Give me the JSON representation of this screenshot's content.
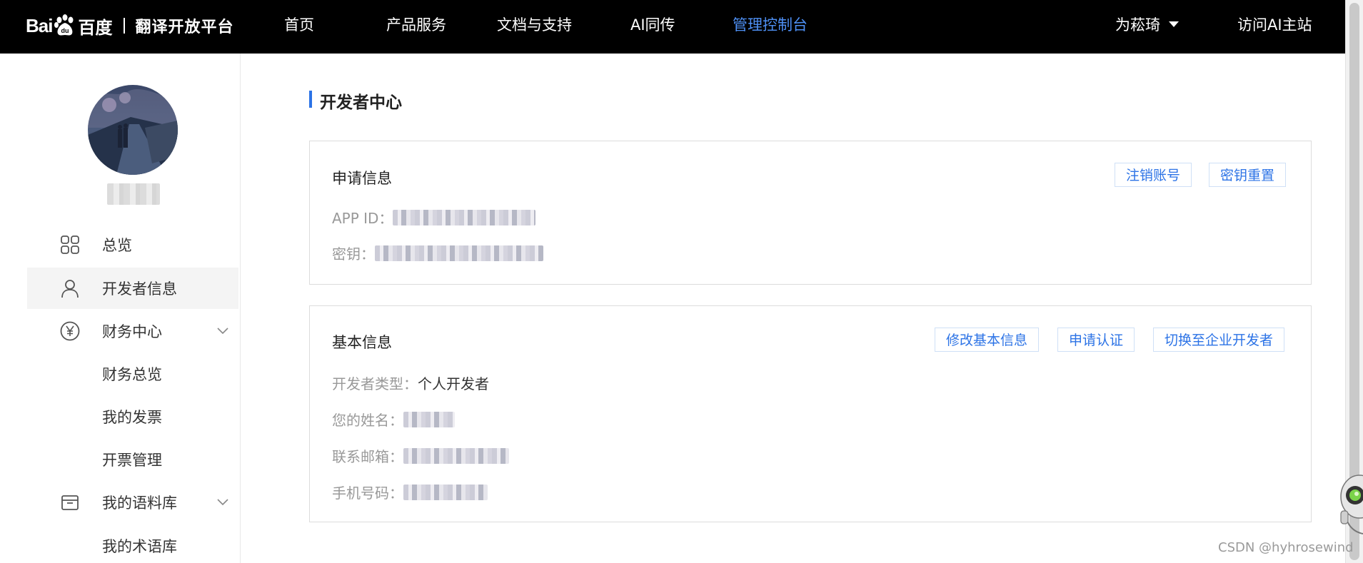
{
  "header": {
    "logo_bai": "Bai",
    "logo_du": "百度",
    "logo_platform": "翻译开放平台",
    "nav": [
      {
        "label": "首页"
      },
      {
        "label": "产品服务"
      },
      {
        "label": "文档与支持"
      },
      {
        "label": "AI同传"
      },
      {
        "label": "管理控制台",
        "active": true
      }
    ],
    "user_name": "为菘琦",
    "visit_ai": "访问AI主站"
  },
  "sidebar": {
    "items": [
      {
        "label": "总览",
        "icon": "grid-icon"
      },
      {
        "label": "开发者信息",
        "icon": "user-icon",
        "selected": true
      },
      {
        "label": "财务中心",
        "icon": "yen-icon",
        "expandable": true
      },
      {
        "label": "财务总览"
      },
      {
        "label": "我的发票"
      },
      {
        "label": "开票管理"
      },
      {
        "label": "我的语料库",
        "icon": "box-icon",
        "expandable": true
      },
      {
        "label": "我的术语库"
      }
    ]
  },
  "main": {
    "page_title": "开发者中心",
    "application_card": {
      "title": "申请信息",
      "buttons": [
        "注销账号",
        "密钥重置"
      ],
      "fields": [
        {
          "label": "APP ID："
        },
        {
          "label": "密钥："
        }
      ]
    },
    "basic_card": {
      "title": "基本信息",
      "buttons": [
        "修改基本信息",
        "申请认证",
        "切换至企业开发者"
      ],
      "fields": [
        {
          "label": "开发者类型：",
          "value": "个人开发者"
        },
        {
          "label": "您的姓名："
        },
        {
          "label": "联系邮箱："
        },
        {
          "label": "手机号码："
        }
      ]
    }
  },
  "watermark": "CSDN @hyhrosewind",
  "colors": {
    "accent": "#2c73e6",
    "nav_active": "#4e90f5",
    "topbar_bg": "#000000"
  }
}
